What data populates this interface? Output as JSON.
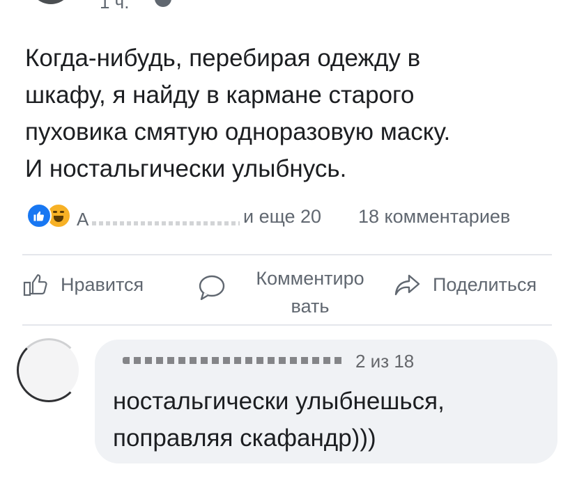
{
  "header": {
    "time": "1 ч."
  },
  "post": {
    "lines": [
      "Когда-нибудь, перебирая одежду в",
      "шкафу, я найду в кармане старого",
      "пуховика смятую одноразовую маску.",
      "И ностальгически улыбнусь."
    ]
  },
  "reactions": {
    "icons": [
      "like-icon",
      "haha-icon"
    ],
    "first_reactor_initial": "А",
    "and_more": "и еще 20",
    "comments_count": "18 комментариев"
  },
  "actions": {
    "like": "Нравится",
    "comment_line1": "Комментиро",
    "comment_line2": "вать",
    "share": "Поделиться"
  },
  "comment": {
    "meta": "2 из 18",
    "lines": [
      "ностальгически улыбнешься,",
      "поправляя скафандр)))"
    ]
  },
  "colors": {
    "text": "#1c1e21",
    "secondary_text": "#606770",
    "like_blue": "#1877f2",
    "haha_yellow": "#f7b125",
    "bubble_bg": "#f0f2f5",
    "divider": "#e4e6eb"
  }
}
